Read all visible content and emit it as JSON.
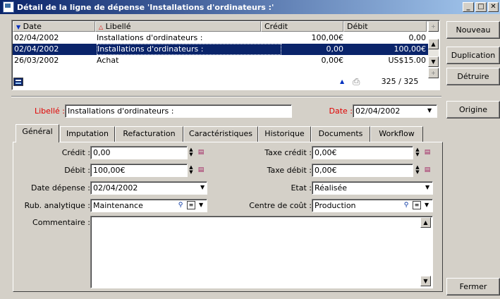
{
  "window": {
    "title": "Détail de la ligne de dépense 'Installations d'ordinateurs :'",
    "minimize": "_",
    "maximize": "□",
    "close": "✕"
  },
  "list": {
    "columns": [
      "Date",
      "Libellé",
      "Crédit",
      "Débit"
    ],
    "rows": [
      {
        "date": "02/04/2002",
        "libelle": "Installations d'ordinateurs :",
        "credit": "100,00€",
        "debit": "0,00"
      },
      {
        "date": "02/04/2002",
        "libelle": "Installations d'ordinateurs :",
        "credit": "0,00",
        "debit": "100,00€",
        "selected": true
      },
      {
        "date": "26/03/2002",
        "libelle": "Achat",
        "credit": "0,00€",
        "debit": "US$15.00"
      }
    ],
    "count": "325 / 325"
  },
  "side_buttons": {
    "nouveau": "Nouveau",
    "duplication": "Duplication",
    "detruire": "Détruire",
    "origine": "Origine",
    "fermer": "Fermer"
  },
  "header_fields": {
    "libelle_label": "Libellé :",
    "libelle_value": "Installations d'ordinateurs :",
    "date_label": "Date :",
    "date_value": "02/04/2002"
  },
  "tabs": [
    "Général",
    "Imputation",
    "Refacturation",
    "Caractéristiques",
    "Historique",
    "Documents",
    "Workflow"
  ],
  "general": {
    "credit_label": "Crédit :",
    "credit_value": "0,00",
    "debit_label": "Débit :",
    "debit_value": "100,00€",
    "date_depense_label": "Date dépense :",
    "date_depense_value": "02/04/2002",
    "rub_label": "Rub. analytique :",
    "rub_value": "Maintenance",
    "commentaire_label": "Commentaire :",
    "commentaire_value": "",
    "taxe_credit_label": "Taxe crédit :",
    "taxe_credit_value": "0,00€",
    "taxe_debit_label": "Taxe débit :",
    "taxe_debit_value": "0,00€",
    "etat_label": "Etat :",
    "etat_value": "Réalisée",
    "centre_label": "Centre de coût :",
    "centre_value": "Production"
  },
  "colors": {
    "title_start": "#0a246a",
    "title_end": "#a6caf0",
    "selection": "#0a246a",
    "required_label": "#e00000"
  }
}
